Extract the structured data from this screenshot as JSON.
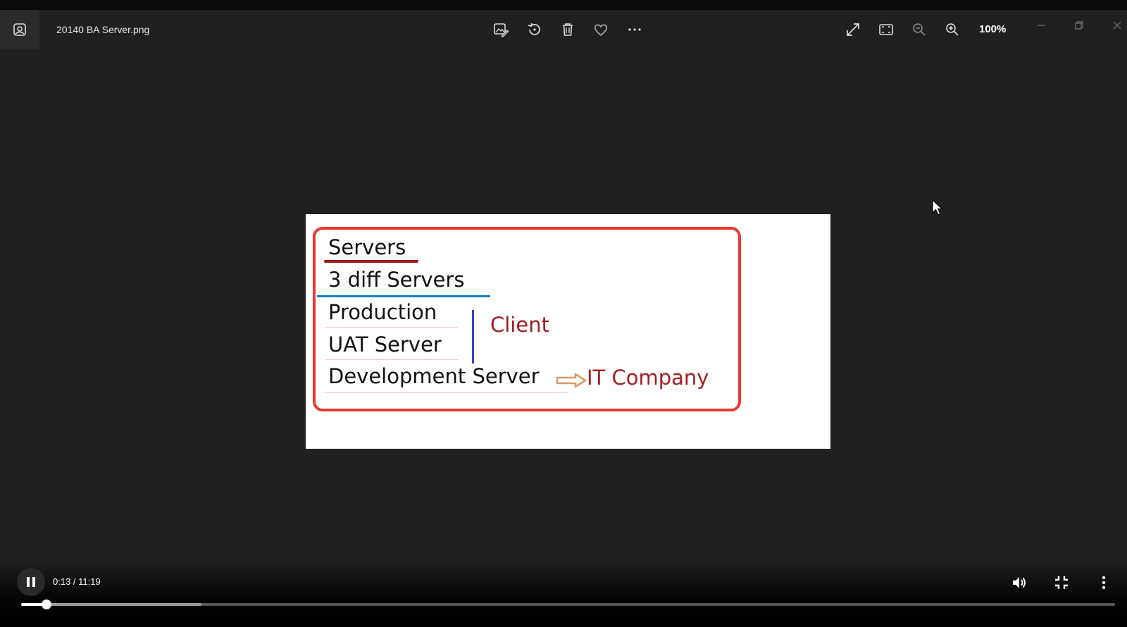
{
  "window": {
    "title": "20140 BA Server.png",
    "zoom_level": "100%"
  },
  "toolbar": {
    "icons": [
      "app-photo-icon",
      "edit-image-icon",
      "rotate-icon",
      "delete-icon",
      "favorite-icon",
      "more-icon",
      "fullscreen-icon",
      "fit-icon",
      "zoom-out-icon",
      "zoom-in-icon"
    ]
  },
  "slide": {
    "title": "Servers",
    "line2": "3 diff Servers",
    "line3": "Production",
    "line4": "UAT Server",
    "line5": "Development Server",
    "client": "Client",
    "company": "IT Company",
    "colors": {
      "frame": "#e8392f",
      "underline_title": "#9b1c1c",
      "underline_blue": "#1a7fd4",
      "bracket": "#3b3bd0",
      "arrow": "#d89a6a"
    }
  },
  "player": {
    "time": "0:13 / 11:19",
    "progress_fraction": 0.023,
    "buffered_fraction": 0.165
  }
}
